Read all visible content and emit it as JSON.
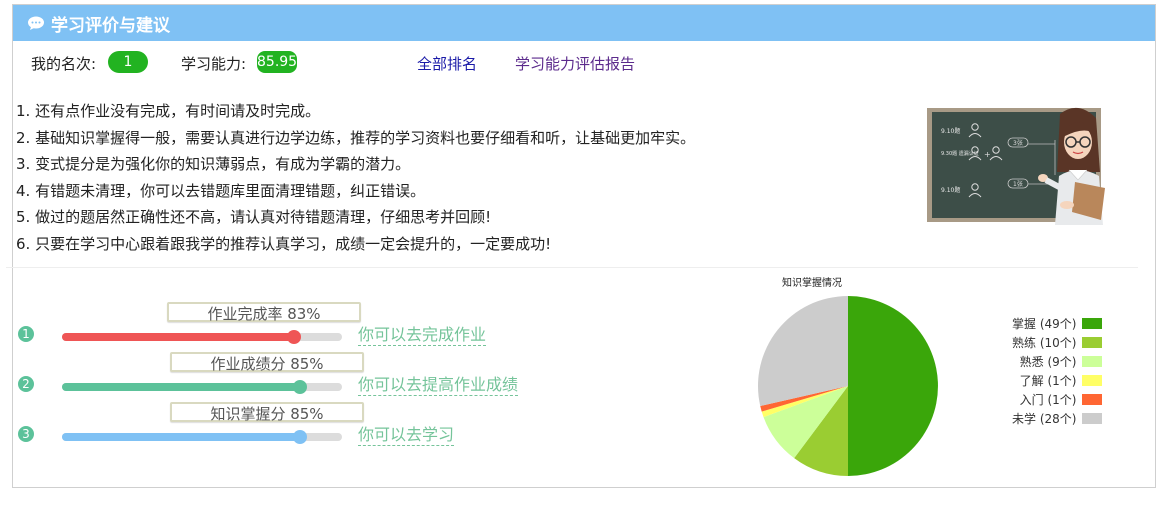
{
  "header": {
    "title": "学习评价与建议",
    "icon": "chat-icon"
  },
  "rank": {
    "label": "我的名次:",
    "value": "1"
  },
  "ability": {
    "label": "学习能力:",
    "value": "85.95"
  },
  "links": {
    "all_rank": "全部排名",
    "report": "学习能力评估报告"
  },
  "advice": [
    "1. 还有点作业没有完成，有时间请及时完成。",
    "2. 基础知识掌握得一般，需要认真进行边学边练，推荐的学习资料也要仔细看和听，让基础更加牢实。",
    "3. 变式提分是为强化你的知识薄弱点，有成为学霸的潜力。",
    "4. 有错题未清理，你可以去错题库里面清理错题，纠正错误。",
    "5. 做过的题居然正确性还不高，请认真对待错题清理，仔细思考并回顾!",
    "6. 只要在学习中心跟着跟我学的推荐认真学习，成绩一定会提升的，一定要成功!"
  ],
  "teacher_board": {
    "rows": [
      "9.10题",
      "9.30题 遗漏认证",
      "9.10题"
    ],
    "tags": [
      "3张",
      "1张"
    ]
  },
  "metrics": [
    {
      "num": "1",
      "label": "作业完成率 83%",
      "percent": 83,
      "color": "#ef5555",
      "action": "你可以去完成作业"
    },
    {
      "num": "2",
      "label": "作业成绩分 85%",
      "percent": 85,
      "color": "#5cc29a",
      "action": "你可以去提高作业成绩"
    },
    {
      "num": "3",
      "label": "知识掌握分 85%",
      "percent": 85,
      "color": "#7fc1f4",
      "action": "你可以去学习"
    }
  ],
  "chart_data": {
    "type": "pie",
    "title": "知识掌握情况",
    "legend_position": "right",
    "series": [
      {
        "name": "掌握",
        "value": 49,
        "label": "掌握 (49个)",
        "color": "#3aa60a"
      },
      {
        "name": "熟练",
        "value": 10,
        "label": "熟练 (10个)",
        "color": "#9acd32"
      },
      {
        "name": "熟悉",
        "value": 9,
        "label": "熟悉 (9个)",
        "color": "#ccff99"
      },
      {
        "name": "了解",
        "value": 1,
        "label": "了解 (1个)",
        "color": "#ffff66"
      },
      {
        "name": "入门",
        "value": 1,
        "label": "入门 (1个)",
        "color": "#ff6633"
      },
      {
        "name": "未学",
        "value": 28,
        "label": "未学 (28个)",
        "color": "#cccccc"
      }
    ]
  }
}
